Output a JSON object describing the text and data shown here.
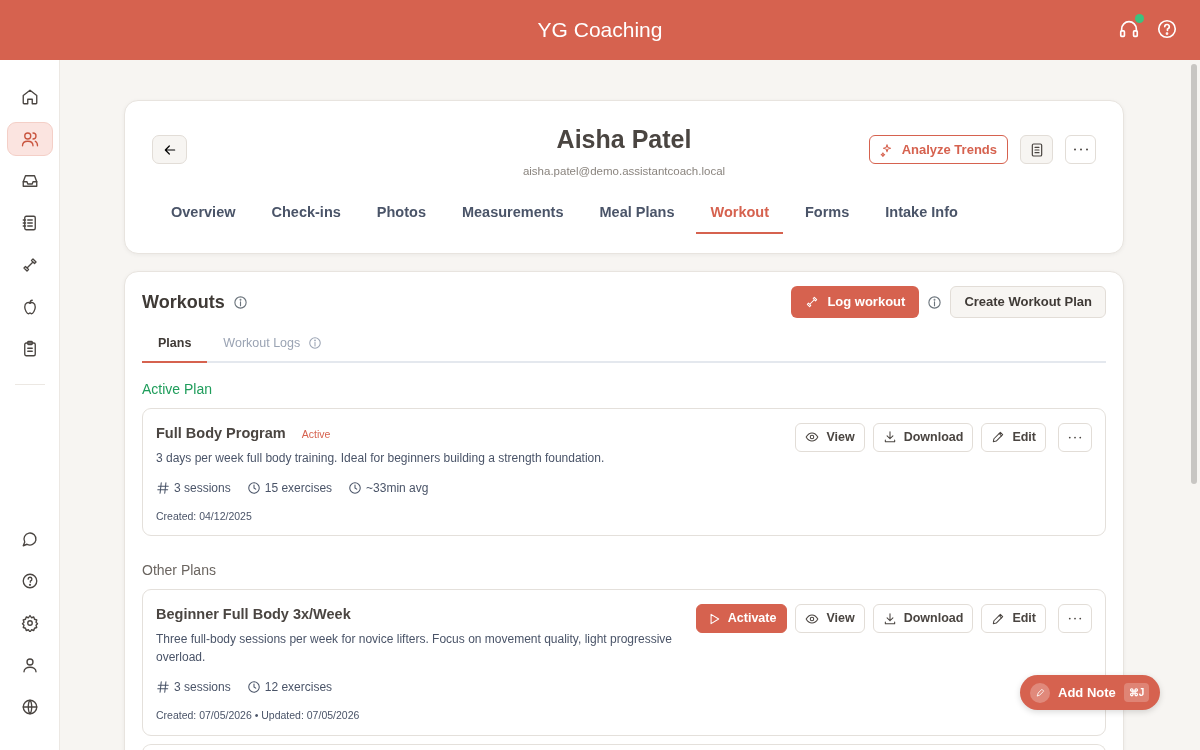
{
  "app_title": "YG Coaching",
  "header_icons": [
    {
      "kind": "headset",
      "online": true
    },
    {
      "kind": "help"
    }
  ],
  "sidebar": {
    "items": [
      {
        "kind": "home",
        "selected": false
      },
      {
        "kind": "users",
        "selected": true
      },
      {
        "kind": "inbox",
        "selected": false
      },
      {
        "kind": "notebook",
        "selected": false
      },
      {
        "kind": "dumbbell",
        "selected": false
      },
      {
        "kind": "apple",
        "selected": false
      },
      {
        "kind": "clipboard",
        "selected": false
      }
    ],
    "bottom_items": [
      {
        "kind": "chat",
        "selected": false
      },
      {
        "kind": "help",
        "selected": false
      },
      {
        "kind": "gear",
        "selected": false
      },
      {
        "kind": "user",
        "selected": false
      },
      {
        "kind": "globe",
        "selected": false
      }
    ]
  },
  "client": {
    "name": "Aisha Patel",
    "email": "aisha.patel@demo.assistantcoach.local"
  },
  "header_actions": [
    {
      "kind": "analyze",
      "label": "Analyze Trends"
    },
    {
      "kind": "notes"
    },
    {
      "kind": "more"
    }
  ],
  "tabs": [
    {
      "label": "Overview",
      "selected": false
    },
    {
      "label": "Check-ins",
      "selected": false
    },
    {
      "label": "Photos",
      "selected": false
    },
    {
      "label": "Measurements",
      "selected": false
    },
    {
      "label": "Meal Plans",
      "selected": false
    },
    {
      "label": "Workout",
      "selected": true
    },
    {
      "label": "Forms",
      "selected": false
    },
    {
      "label": "Intake Info",
      "selected": false
    }
  ],
  "workouts": {
    "title": "Workouts",
    "log_button": "Log workout",
    "create_button": "Create Workout Plan",
    "subtabs": [
      {
        "label": "Plans",
        "selected": true,
        "info": false
      },
      {
        "label": "Workout Logs",
        "selected": false,
        "info": true
      }
    ],
    "active_heading": "Active Plan",
    "active_plans": [
      {
        "name": "Full Body Program",
        "badge": "Active",
        "description": "3 days per week full body training. Ideal for beginners building a strength foundation.",
        "stats": [
          {
            "kind": "sessions",
            "text": "3 sessions"
          },
          {
            "kind": "exercises",
            "text": "15 exercises"
          },
          {
            "kind": "duration",
            "text": "~33min avg"
          }
        ],
        "dates": "Created: 04/12/2025",
        "actions": [
          {
            "kind": "view",
            "label": "View"
          },
          {
            "kind": "download",
            "label": "Download"
          },
          {
            "kind": "edit",
            "label": "Edit"
          },
          {
            "kind": "more"
          }
        ]
      }
    ],
    "other_heading": "Other Plans",
    "other_plans": [
      {
        "name": "Beginner Full Body 3x/Week",
        "description": "Three full-body sessions per week for novice lifters. Focus on movement quality, light progressive overload.",
        "stats": [
          {
            "kind": "sessions",
            "text": "3 sessions"
          },
          {
            "kind": "exercises",
            "text": "12 exercises"
          }
        ],
        "dates": "Created: 07/05/2026 • Updated: 07/05/2026",
        "actions": [
          {
            "kind": "activate",
            "label": "Activate"
          },
          {
            "kind": "view",
            "label": "View"
          },
          {
            "kind": "download",
            "label": "Download"
          },
          {
            "kind": "edit",
            "label": "Edit"
          },
          {
            "kind": "more"
          }
        ]
      }
    ],
    "more_plans_below": true
  },
  "fab": {
    "label": "Add Note",
    "shortcut": "⌘J"
  }
}
